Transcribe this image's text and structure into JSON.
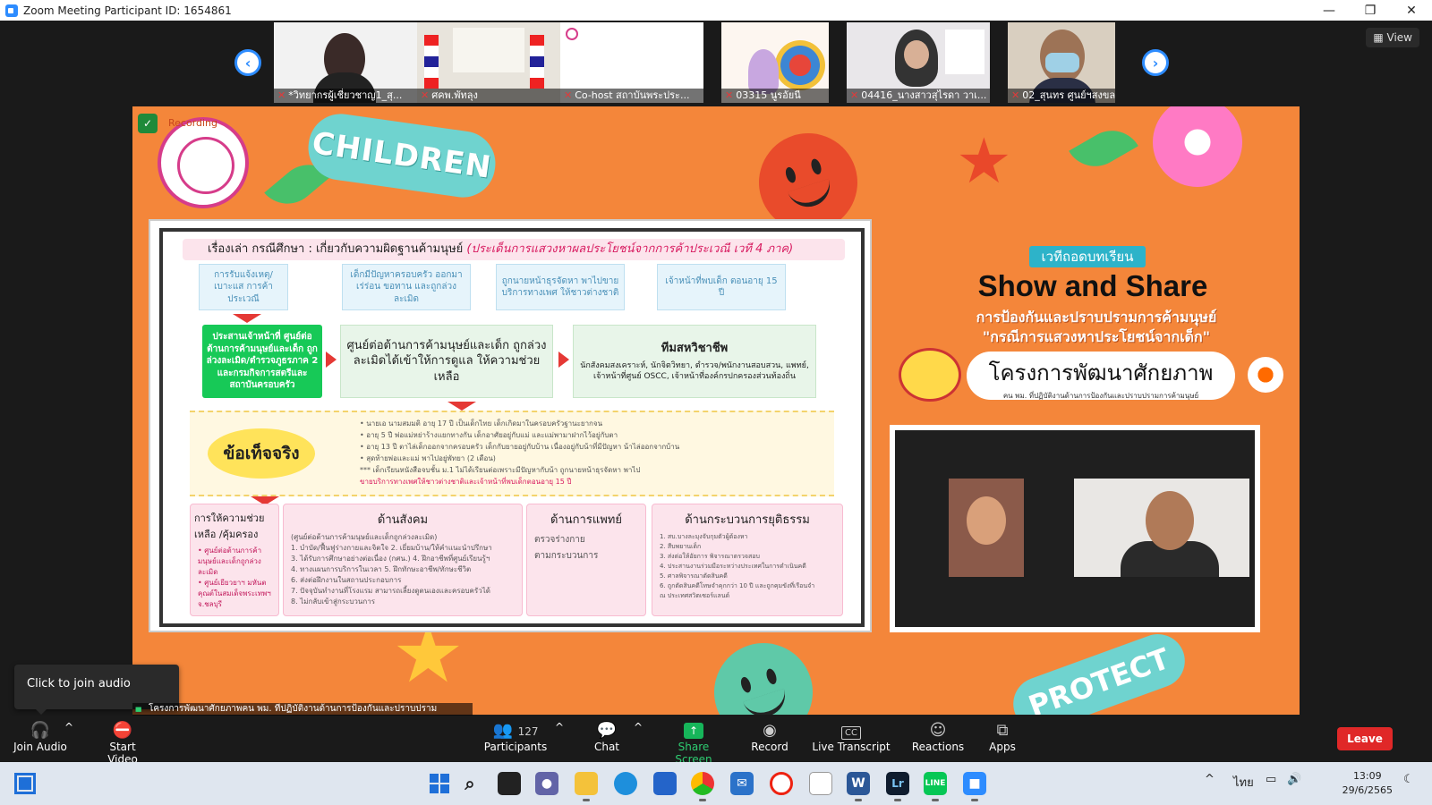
{
  "window": {
    "title": "Zoom Meeting Participant ID: 1654861",
    "minimize": "—",
    "restore": "❐",
    "close": "✕"
  },
  "strip": {
    "prev": "‹",
    "next": "›",
    "view_label": "View",
    "tiles": [
      {
        "name": "*วิทยากรผู้เชี่ยวชาญ1_สุ..."
      },
      {
        "name": "ศคพ.พัทลุง"
      },
      {
        "name": "Co-host สถาบันพระประ..."
      },
      {
        "name": "03315 นูรอัยนี"
      },
      {
        "name": "04416_นางสาวสุไรดา วาเ..."
      },
      {
        "name": "02_สุนทร ศูนย์ฯสงขลา"
      }
    ]
  },
  "share": {
    "recording": "Recording",
    "children": "CHILDREN",
    "protect": "PROTECT",
    "doc": {
      "title_black": "เรื่องเล่า กรณีศึกษา : เกี่ยวกับความผิดฐานค้ามนุษย์",
      "title_red": "(ประเด็นการแสวงหาผลประโยชน์จากการค้าประเวณี เวที 4 ภาค)",
      "top_boxes": [
        "การรับแจ้งเหตุ/ เบาะแส การค้าประเวณี",
        "เด็กมีปัญหาครอบครัว ออกมาเร่ร่อน ขอทาน และถูกล่วงละเมิด",
        "ถูกนายหน้าธุรจัดหา พาไปขายบริการทางเพศ ให้ชาวต่างชาติ",
        "เจ้าหน้าที่พบเด็ก ตอนอายุ 15 ปี"
      ],
      "green_box": "ประสานเจ้าหน้าที่ ศูนย์ต่อต้านการค้ามนุษย์และเด็ก ถูกล่วงละเมิด/ตำรวจภูธรภาค 2 และกรมกิจการสตรีและสถาบันครอบครัว",
      "center_box": "ศูนย์ต่อต้านการค้ามนุษย์และเด็ก ถูกล่วงละเมิดได้เข้าให้การดูแล ให้ความช่วยเหลือ",
      "team_title": "ทีมสหวิชาชีพ",
      "team_text": "นักสังคมสงเคราะห์, นักจิตวิทยา, ตำรวจ/พนักงานสอบสวน, แพทย์, เจ้าหน้าที่ศูนย์ OSCC, เจ้าหน้าที่องค์กรปกครองส่วนท้องถิ่น",
      "facts_label": "ข้อเท็จจริง",
      "facts_lines": [
        "• นายเอ นามสมมติ อายุ 17 ปี เป็นเด็กไทย เด็กเกิดมาในครอบครัวฐานะยากจน",
        "• อายุ 5 ปี พ่อแม่หย่าร้างแยกทางกัน เด็กอาศัยอยู่กับแม่ และแม่พามาฝากไว้อยู่กับตา",
        "• อายุ 13 ปี ตาไล่เด็กออกจากครอบครัว เด็กกับยายอยู่กับบ้าน เนื่องอยู่กับน้าที่มีปัญหา น้าไล่ออกจากบ้าน",
        "• สุดท้ายพ่อและแม่ พาไปอยู่พัทยา (2 เดือน)",
        "*** เด็กเรียนหนังสือจบชั้น ม.1 ไม่ได้เรียนต่อเพราะมีปัญหากับน้า ถูกนายหน้าธุรจัดหา พาไป",
        "ขายบริการทางเพศให้ชาวต่างชาติและเจ้าหน้าที่พบเด็กตอนอายุ 15 ปี"
      ],
      "help_title": "การให้ความช่วยเหลือ /คุ้มครอง",
      "help_lines": [
        "• ศูนย์ต่อต้านการค้ามนุษย์และเด็กถูกล่วงละเมิด",
        "• ศูนย์เยียวยาฯ มหันตคุณต์ในสมเด็จพระเทพฯ จ.ชลบุรี"
      ],
      "social_title": "ด้านสังคม",
      "social_lines": [
        "(ศูนย์ต่อต้านการค้ามนุษย์และเด็กถูกล่วงละเมิด)",
        "1. บำบัด/ฟื้นฟูร่างกายและจิตใจ   2. เยี่ยมบ้าน/ให้คำแนะนำปรึกษา",
        "3. ได้รับการศึกษาอย่างต่อเนื่อง (กศน.)   4. ฝึกอาชีพที่ศูนย์เรียนรู้ฯ",
        "4. ทางแผนการบริการในเวลา   5. ฝึกทักษะอาชีพ/ทักษะชีวิต",
        "6. ส่งต่อฝึกงานในสถานประกอบการ",
        "7. ปัจจุบันทำงานที่โรงแรม สามารถเลี้ยงดูตนเองและครอบครัวได้",
        "8. ไม่กลับเข้าสู่กระบวนการ"
      ],
      "medical_title": "ด้านการแพทย์",
      "medical_lines": [
        "ตรวจร่างกาย",
        "ตามกระบวนการ"
      ],
      "justice_title": "ด้านกระบวนการยุติธรรม",
      "justice_lines": [
        "1. สบ.บางละมุงจับกุมตัวผู้ต้องหา",
        "2. สืบพยานเด็ก",
        "3. ส่งต่อให้อัยการ พิจารณาตรวจสอบ",
        "4. ประสานงานร่วมมือระหว่างประเทศในการดำเนินคดี",
        "5. ศาลพิจารณาตัดสินคดี",
        "6. ถูกตัดสินคดีโทษจำคุกกว่า 10 ปี และถูกคุมขังที่เรือนจำ",
        "ณ ประเทศสวิตเซอร์แลนด์"
      ]
    },
    "banner": {
      "pill": "เวทีถอดบทเรียน",
      "headline": "Show and Share",
      "line1": "การป้องกันและปราบปรามการค้ามนุษย์",
      "line2": "\"กรณีการแสวงหาประโยชน์จากเด็ก\"",
      "project": "โครงการพัฒนาศักยภาพ",
      "project_sub": "คน พม. ที่ปฏิบัติงานด้านการป้องกันและปราบปรามการค้ามนุษย์"
    }
  },
  "audio_tip": "Click to join audio",
  "active_speaker": "โครงการพัฒนาศักยภาพคน พม. ที่ปฏิบัติงานด้านการป้องกันและปราบปราม",
  "toolbar": {
    "join_audio": "Join Audio",
    "start_video": "Start Video",
    "participants": "Participants",
    "participant_count": "127",
    "chat": "Chat",
    "share_screen": "Share Screen",
    "record": "Record",
    "live_transcript": "Live Transcript",
    "reactions": "Reactions",
    "apps": "Apps",
    "leave": "Leave",
    "cc": "CC",
    "caret": "^"
  },
  "taskbar": {
    "lang": "ไทย",
    "time": "13:09",
    "date": "29/6/2565",
    "chevron": "^"
  },
  "colors": {
    "zoom_blue": "#2d8cff",
    "share_green": "#16b55a",
    "leave_red": "#e02828",
    "slide_orange": "#f4863a"
  }
}
